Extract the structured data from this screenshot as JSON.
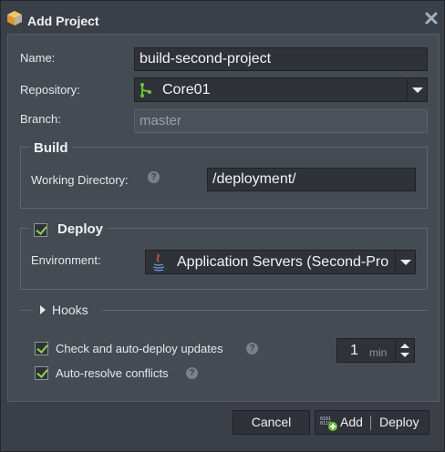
{
  "dialog": {
    "title": "Add Project",
    "title_icon": "package-icon",
    "close_icon": "close-icon"
  },
  "form": {
    "name_label": "Name:",
    "name_value": "build-second-project",
    "repository_label": "Repository:",
    "repository_value": "Core01",
    "repository_icon": "git-branch-icon",
    "branch_label": "Branch:",
    "branch_placeholder": "master"
  },
  "build": {
    "legend": "Build",
    "working_dir_label": "Working Directory:",
    "working_dir_value": "/deployment/"
  },
  "deploy": {
    "legend": "Deploy",
    "checked": true,
    "environment_label": "Environment:",
    "environment_value": "Application Servers (Second-Pro",
    "environment_icon": "java-icon"
  },
  "hooks": {
    "label": "Hooks"
  },
  "options": {
    "auto_deploy_label": "Check and auto-deploy updates",
    "auto_deploy_checked": true,
    "interval_value": "1",
    "interval_unit": "min",
    "auto_resolve_label": "Auto-resolve conflicts",
    "auto_resolve_checked": true
  },
  "footer": {
    "cancel_label": "Cancel",
    "add_label": "Add",
    "deploy_label": "Deploy"
  },
  "colors": {
    "accent_check": "#8fd34b",
    "background": "#3b4048",
    "panel": "#454b53"
  }
}
